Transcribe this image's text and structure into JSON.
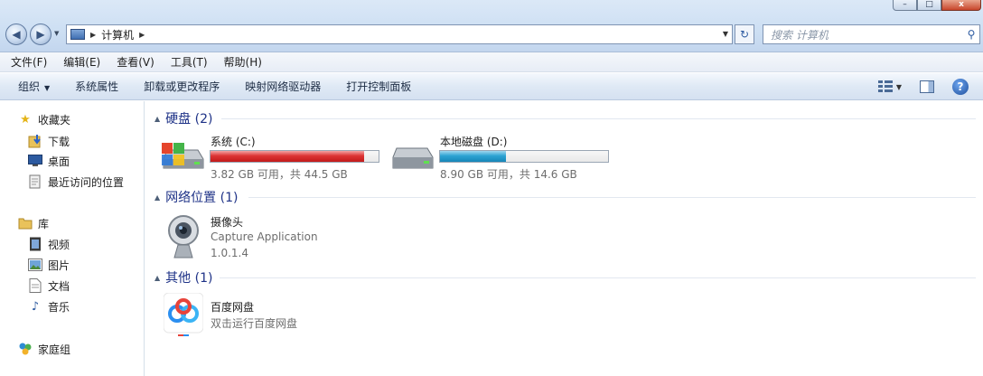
{
  "window": {
    "buttons": {
      "minimize": "–",
      "maximize": "□",
      "close": "x"
    }
  },
  "address": {
    "breadcrumb": "计算机",
    "search_placeholder": "搜索 计算机"
  },
  "menu": [
    "文件(F)",
    "编辑(E)",
    "查看(V)",
    "工具(T)",
    "帮助(H)"
  ],
  "commands": [
    "组织",
    "系统属性",
    "卸载或更改程序",
    "映射网络驱动器",
    "打开控制面板"
  ],
  "nav": {
    "favorites": {
      "label": "收藏夹",
      "items": [
        "下载",
        "桌面",
        "最近访问的位置"
      ]
    },
    "libraries": {
      "label": "库",
      "items": [
        "视频",
        "图片",
        "文档",
        "音乐"
      ]
    },
    "homegroup": {
      "label": "家庭组"
    }
  },
  "groups": {
    "hard_disks": {
      "title": "硬盘 (2)",
      "drives": [
        {
          "name": "系统 (C:)",
          "info": "3.82 GB 可用，共 44.5 GB",
          "used_fraction": 0.914,
          "color": "#d52a2a"
        },
        {
          "name": "本地磁盘 (D:)",
          "info": "8.90 GB 可用，共 14.6 GB",
          "used_fraction": 0.39,
          "color": "#2da3d3"
        }
      ]
    },
    "network": {
      "title": "网络位置 (1)",
      "item": {
        "name": "摄像头",
        "desc": "Capture Application",
        "version": "1.0.1.4"
      }
    },
    "other": {
      "title": "其他 (1)",
      "item": {
        "name": "百度网盘",
        "desc": "双击运行百度网盘"
      }
    }
  }
}
